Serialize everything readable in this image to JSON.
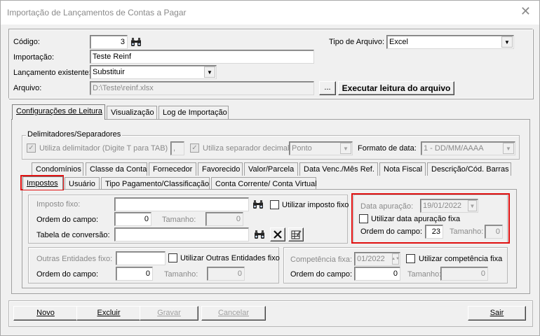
{
  "window": {
    "title": "Importação de Lançamentos de Contas a Pagar",
    "close": "✕"
  },
  "header": {
    "codigo_label": "Código:",
    "codigo_value": "3",
    "tipo_arquivo_label": "Tipo de Arquivo:",
    "tipo_arquivo_value": "Excel",
    "importacao_label": "Importação:",
    "importacao_value": "Teste Reinf",
    "lancamento_label": "Lançamento existente:",
    "lancamento_value": "Substituir",
    "arquivo_label": "Arquivo:",
    "arquivo_value": "D:\\Teste\\reinf.xlsx",
    "browse_label": "...",
    "executar_label": "Executar leitura do arquivo"
  },
  "main_tabs": [
    "Configurações de Leitura",
    "Visualização",
    "Log de Importação"
  ],
  "delimitadores": {
    "title": "Delimitadores/Separadores",
    "utiliza_delimitador": "Utiliza delimitador (Digite T para TAB)",
    "delimitador_value": ",",
    "utiliza_separador": "Utiliza separador decimal",
    "separador_value": "Ponto",
    "formato_label": "Formato de data:",
    "formato_value": "1 - DD/MM/AAAA"
  },
  "sub_tabs_row1": [
    "Condomínios",
    "Classe da Conta",
    "Fornecedor",
    "Favorecido",
    "Valor/Parcela",
    "Data Venc./Mês Ref.",
    "Nota Fiscal",
    "Descrição/Cód. Barras"
  ],
  "sub_tabs_row2": [
    "Impostos",
    "Usuário",
    "Tipo Pagamento/Classificação",
    "Conta Corrente/ Conta Virtual"
  ],
  "impostos": {
    "imposto_fixo_label": "Imposto fixo:",
    "imposto_fixo_value": "",
    "utilizar_imposto_fixo": "Utilizar imposto fixo",
    "ordem_label": "Ordem do campo:",
    "ordem_value": "0",
    "tamanho_label": "Tamanho:",
    "tamanho_value": "0",
    "tabela_label": "Tabela de conversão:",
    "tabela_value": ""
  },
  "data_apuracao": {
    "label": "Data apuração:",
    "value": "19/01/2022",
    "utilizar_fixa": "Utilizar data apuração fixa",
    "ordem_label": "Ordem do campo:",
    "ordem_value": "23",
    "tamanho_label": "Tamanho:",
    "tamanho_value": "0"
  },
  "outras_entidades": {
    "fixo_label": "Outras Entidades fixo:",
    "fixo_value": "",
    "utilizar": "Utilizar Outras Entidades fixo",
    "ordem_label": "Ordem do campo:",
    "ordem_value": "0",
    "tamanho_label": "Tamanho:",
    "tamanho_value": "0"
  },
  "competencia": {
    "fixa_label": "Competência fixa:",
    "fixa_value": "01/2022",
    "utilizar": "Utilizar competência fixa",
    "ordem_label": "Ordem do campo:",
    "ordem_value": "0",
    "tamanho_label": "Tamanho:",
    "tamanho_value": "0"
  },
  "footer": {
    "novo": "Novo",
    "excluir": "Excluir",
    "gravar": "Gravar",
    "cancelar": "Cancelar",
    "sair": "Sair"
  },
  "icons": {
    "search": "binoculars-icon",
    "clear": "x-icon",
    "edit": "table-edit-icon",
    "dropdown": "chevron-down-icon"
  },
  "colors": {
    "highlight": "#e01010",
    "window_bg": "#f0f0f0"
  }
}
